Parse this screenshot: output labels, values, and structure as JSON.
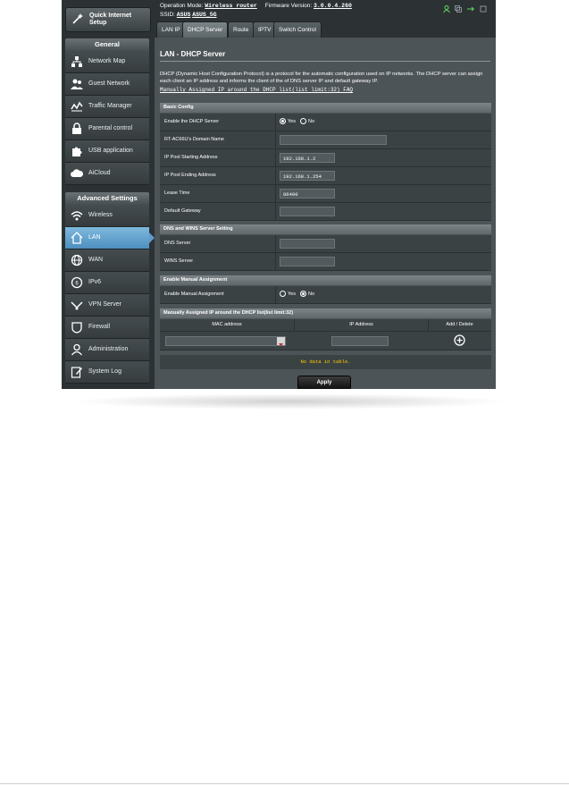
{
  "sidebar": {
    "quick_setup": "Quick Internet Setup",
    "general_title": "General",
    "general_items": [
      "Network Map",
      "Guest Network",
      "Traffic Manager",
      "Parental control",
      "USB application",
      "AiCloud"
    ],
    "advanced_title": "Advanced Settings",
    "advanced_items": [
      "Wireless",
      "LAN",
      "WAN",
      "IPv6",
      "VPN Server",
      "Firewall",
      "Administration",
      "System Log"
    ],
    "active_item": "LAN"
  },
  "topbar": {
    "operation_mode_label": "Operation Mode:",
    "operation_mode_value": "Wireless router",
    "firmware_label": "Firmware Version:",
    "firmware_value": "3.0.0.4.260",
    "ssid_label": "SSID:",
    "ssid_values": [
      "ASUS",
      "ASUS_5G"
    ]
  },
  "tabs": [
    "LAN IP",
    "DHCP Server",
    "Route",
    "IPTV",
    "Switch Control"
  ],
  "active_tab": "DHCP Server",
  "page": {
    "title": "LAN - DHCP Server",
    "description": "DHCP (Dynamic Host Configuration Protocol) is a protocol for the automatic configuration used on IP networks. The DHCP server can assign each client an IP address and informs the client of the of DNS server IP and default gateway IP.",
    "faq_link": "Manually Assigned IP around the DHCP list(list limit:32) FAQ"
  },
  "basic_config": {
    "header": "Basic Config",
    "enable_dhcp_label": "Enable the DHCP Server",
    "yes": "Yes",
    "no": "No",
    "enable_dhcp_value": "Yes",
    "domain_label": "RT-AC66U's Domain Name",
    "domain_value": "",
    "pool_start_label": "IP Pool Starting Address",
    "pool_start_value": "192.168.1.2",
    "pool_end_label": "IP Pool Ending Address",
    "pool_end_value": "192.168.1.254",
    "lease_label": "Lease Time",
    "lease_value": "86400",
    "gateway_label": "Default Gateway",
    "gateway_value": ""
  },
  "dns_wins": {
    "header": "DNS and WINS Server Setting",
    "dns_label": "DNS Server",
    "dns_value": "",
    "wins_label": "WINS Server",
    "wins_value": ""
  },
  "manual": {
    "header": "Enable Manual Assignment",
    "label": "Enable Manual Assignment",
    "yes": "Yes",
    "no": "No",
    "value": "No"
  },
  "manual_list": {
    "header": "Manually Assigned IP around the DHCP list(list limit:32)",
    "col_mac": "MAC address",
    "col_ip": "IP Address",
    "col_action": "Add / Delete",
    "empty": "No data in table."
  },
  "apply_label": "Apply"
}
